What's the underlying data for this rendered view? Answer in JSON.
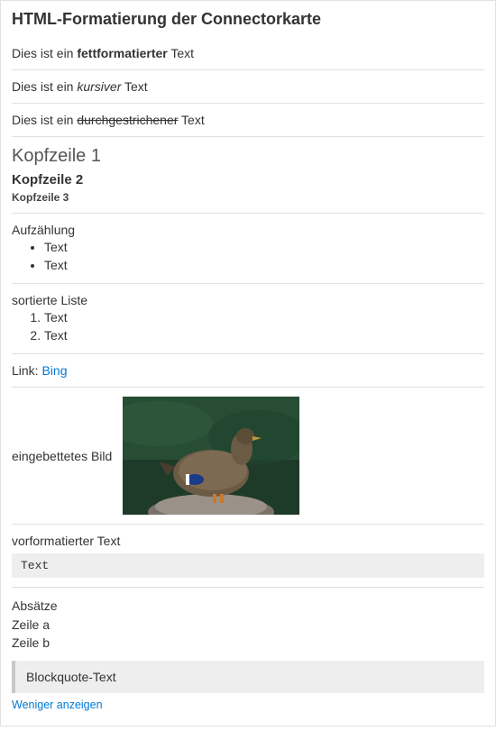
{
  "title": "HTML-Formatierung der Connectorkarte",
  "bold_row": {
    "pre": "Dies ist ein ",
    "word": "fettformatierter",
    "post": " Text"
  },
  "italic_row": {
    "pre": "Dies ist ein ",
    "word": "kursiver",
    "post": " Text"
  },
  "strike_row": {
    "pre": "Dies ist ein ",
    "word": "durchgestrichener",
    "post": " Text"
  },
  "headers": {
    "h1": "Kopfzeile 1",
    "h2": "Kopfzeile 2",
    "h3": "Kopfzeile 3"
  },
  "ulist": {
    "label": "Aufzählung",
    "items": [
      "Text",
      "Text"
    ]
  },
  "olist": {
    "label": "sortierte Liste",
    "items": [
      "Text",
      "Text"
    ]
  },
  "link_row": {
    "label": "Link: ",
    "text": "Bing"
  },
  "image_row": {
    "label": "eingebettetes Bild"
  },
  "pre_row": {
    "label": "vorformatierter Text",
    "code": "Text"
  },
  "paragraphs": {
    "label": "Absätze",
    "line_a": "Zeile a",
    "line_b": "Zeile b"
  },
  "blockquote": "Blockquote-Text",
  "show_less": "Weniger anzeigen"
}
